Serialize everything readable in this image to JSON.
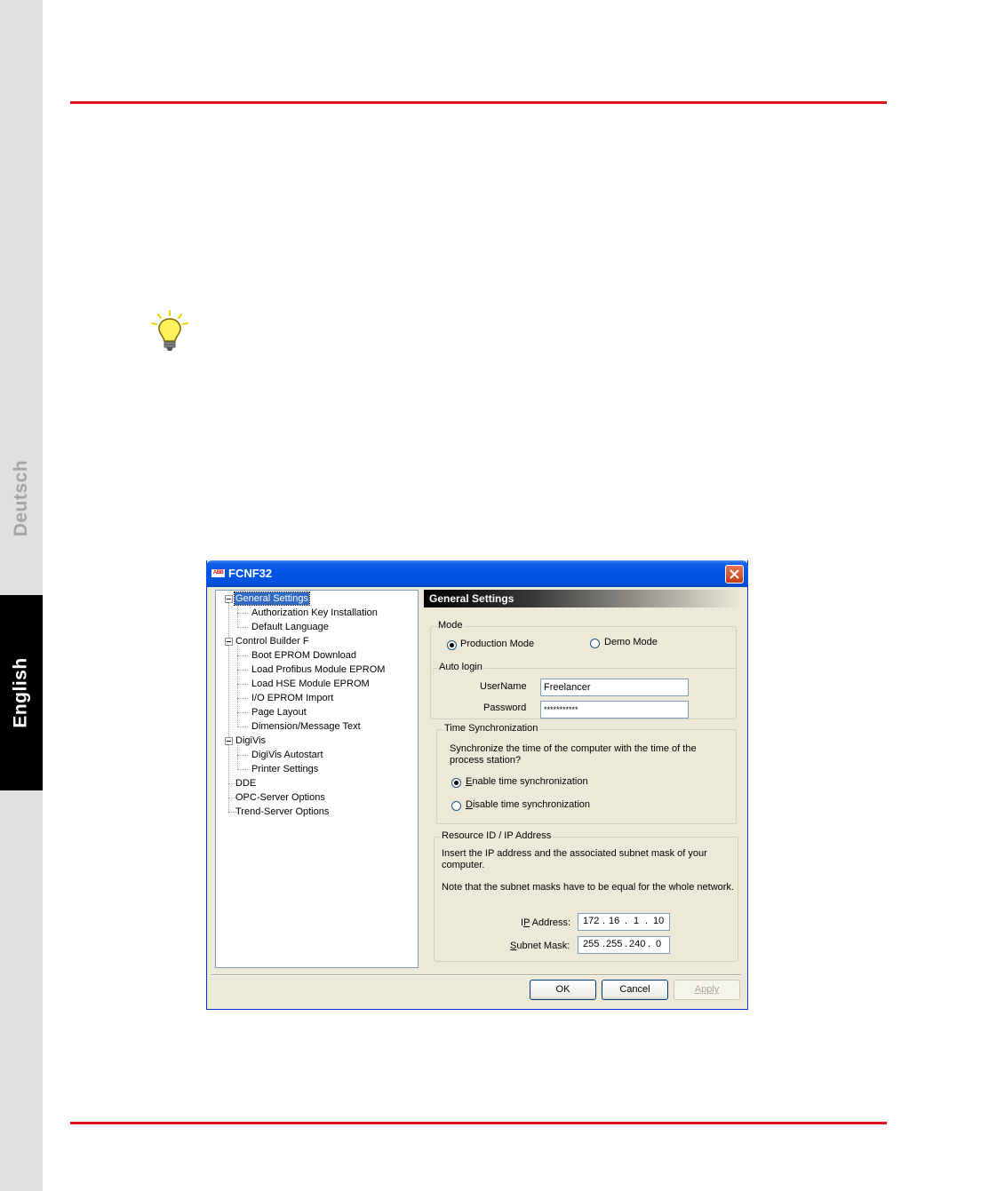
{
  "side_tabs": {
    "deutsch": "Deutsch",
    "english": "English"
  },
  "colors": {
    "rule": "#e0151b",
    "titlebar": "#0055e5",
    "selection": "#316ac5"
  },
  "dialog": {
    "title": "FCNF32",
    "logo_text": "ABB",
    "tree": {
      "items": [
        {
          "label": "General Settings",
          "level": 0,
          "expanded": true,
          "selected": true
        },
        {
          "label": "Authorization Key Installation",
          "level": 1
        },
        {
          "label": "Default Language",
          "level": 1
        },
        {
          "label": "Control Builder F",
          "level": 0,
          "expanded": true
        },
        {
          "label": "Boot EPROM Download",
          "level": 1
        },
        {
          "label": "Load Profibus Module EPROM",
          "level": 1
        },
        {
          "label": "Load HSE Module EPROM",
          "level": 1
        },
        {
          "label": "I/O EPROM Import",
          "level": 1
        },
        {
          "label": "Page Layout",
          "level": 1
        },
        {
          "label": "Dimension/Message Text",
          "level": 1
        },
        {
          "label": "DigiVis",
          "level": 0,
          "expanded": true
        },
        {
          "label": "DigiVis Autostart",
          "level": 1
        },
        {
          "label": "Printer Settings",
          "level": 1
        },
        {
          "label": "DDE",
          "level": 0
        },
        {
          "label": "OPC-Server Options",
          "level": 0
        },
        {
          "label": "Trend-Server Options",
          "level": 0
        }
      ]
    },
    "panel": {
      "header": "General Settings",
      "mode": {
        "label": "Mode",
        "production": "Production Mode",
        "demo": "Demo Mode",
        "selected": "production"
      },
      "auto_login": {
        "label": "Auto login",
        "username_label": "UserName",
        "username_value": "Freelancer",
        "password_label": "Password",
        "password_value": "***********"
      },
      "time_sync": {
        "label": "Time Synchronization",
        "question_line1": "Synchronize the time of the computer with the time of the",
        "question_line2": "process station?",
        "enable_label": "Enable time synchronization",
        "disable_label": "Disable time synchronization",
        "selected": "enable"
      },
      "resource": {
        "label": "Resource ID  /  IP Address",
        "text_line1": "Insert the IP address and the associated subnet mask of your",
        "text_line2": "computer.",
        "note": "Note that the subnet masks have to be equal for the whole network.",
        "ip_label": "IP Address:",
        "ip": [
          "172",
          "16",
          "1",
          "10"
        ],
        "mask_label": "Subnet Mask:",
        "mask": [
          "255",
          "255",
          "240",
          "0"
        ]
      }
    },
    "buttons": {
      "ok": "OK",
      "cancel": "Cancel",
      "apply": "Apply"
    }
  }
}
